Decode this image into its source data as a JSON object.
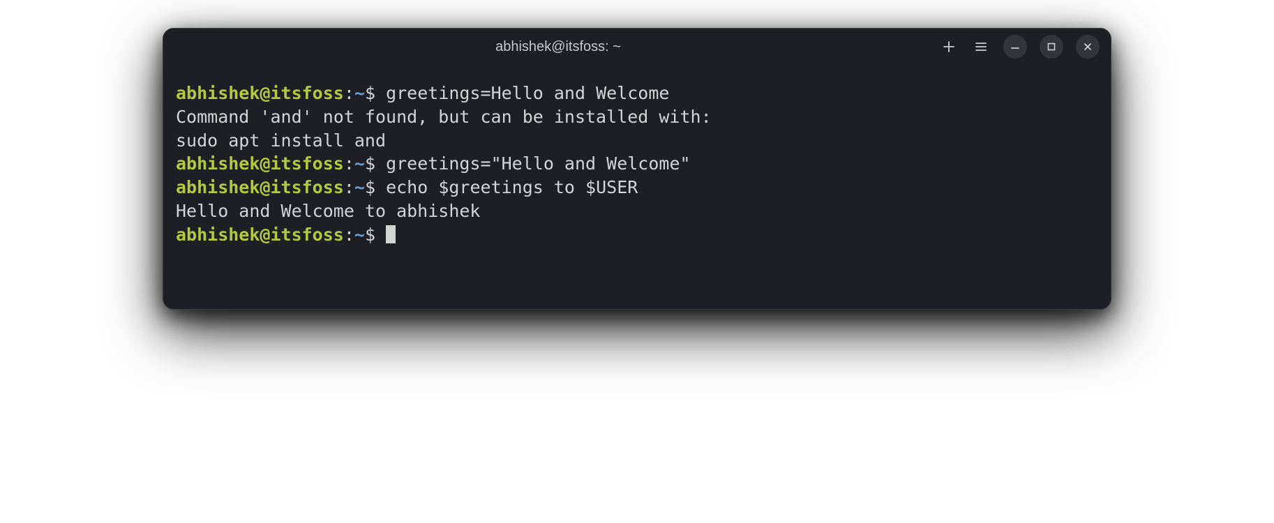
{
  "window": {
    "title": "abhishek@itsfoss: ~"
  },
  "prompt": {
    "user_host": "abhishek@itsfoss",
    "colon": ":",
    "path": "~",
    "symbol": "$ "
  },
  "lines": [
    {
      "type": "cmd",
      "text": "greetings=Hello and Welcome"
    },
    {
      "type": "out",
      "text": "Command 'and' not found, but can be installed with:"
    },
    {
      "type": "out",
      "text": "sudo apt install and"
    },
    {
      "type": "cmd",
      "text": "greetings=\"Hello and Welcome\""
    },
    {
      "type": "cmd",
      "text": "echo $greetings to $USER"
    },
    {
      "type": "out",
      "text": "Hello and Welcome to abhishek"
    },
    {
      "type": "prompt_cursor"
    }
  ]
}
